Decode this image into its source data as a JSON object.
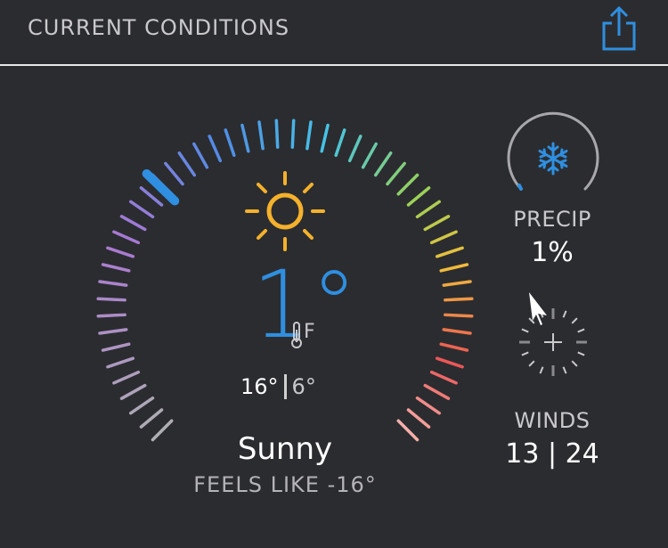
{
  "header": {
    "title": "CURRENT CONDITIONS",
    "share_icon": "share-icon"
  },
  "current": {
    "temperature": "1°",
    "unit": "F",
    "high": "16°",
    "low": "6°",
    "condition": "Sunny",
    "feels_like": "FEELS LIKE -16°",
    "icon": "sun-icon",
    "accent_color": "#2f8fe0"
  },
  "precip": {
    "label": "PRECIP",
    "value": "1%",
    "icon": "snowflake-icon",
    "fraction": 0.01
  },
  "winds": {
    "label": "WINDS",
    "value": "13 | 24",
    "icon": "compass-icon"
  }
}
